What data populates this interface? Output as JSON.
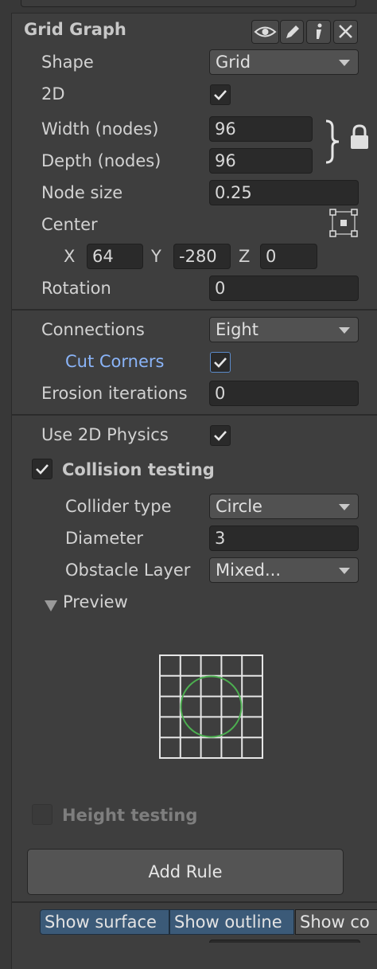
{
  "header": {
    "title": "Grid Graph",
    "icons": [
      "eye-icon",
      "pencil-icon",
      "info-icon",
      "close-icon"
    ]
  },
  "shape": {
    "label": "Shape",
    "value": "Grid"
  },
  "two_d": {
    "label": "2D",
    "checked": true
  },
  "width": {
    "label": "Width (nodes)",
    "value": "96"
  },
  "depth": {
    "label": "Depth (nodes)",
    "value": "96"
  },
  "node_size": {
    "label": "Node size",
    "value": "0.25"
  },
  "center": {
    "label": "Center",
    "x_label": "X",
    "x": "64",
    "y_label": "Y",
    "y": "-280",
    "z_label": "Z",
    "z": "0"
  },
  "rotation": {
    "label": "Rotation",
    "value": "0"
  },
  "connections": {
    "label": "Connections",
    "value": "Eight"
  },
  "cut_corners": {
    "label": "Cut Corners",
    "checked": true
  },
  "erosion": {
    "label": "Erosion iterations",
    "value": "0"
  },
  "physics2d": {
    "label": "Use 2D Physics",
    "checked": true
  },
  "collision": {
    "label": "Collision testing",
    "checked": true
  },
  "collider_type": {
    "label": "Collider type",
    "value": "Circle"
  },
  "diameter": {
    "label": "Diameter",
    "value": "3"
  },
  "obstacle_layer": {
    "label": "Obstacle Layer",
    "value": "Mixed..."
  },
  "preview": {
    "label": "Preview"
  },
  "height_testing": {
    "label": "Height testing",
    "checked": false
  },
  "add_rule": {
    "label": "Add Rule"
  },
  "toolbar": {
    "show_surface": "Show surface",
    "show_outline": "Show outline",
    "show_co": "Show co"
  },
  "colors": {
    "accent_blue": "#8ab4f8",
    "circle_green": "#4caf50",
    "selected_button": "#3b5a78"
  }
}
